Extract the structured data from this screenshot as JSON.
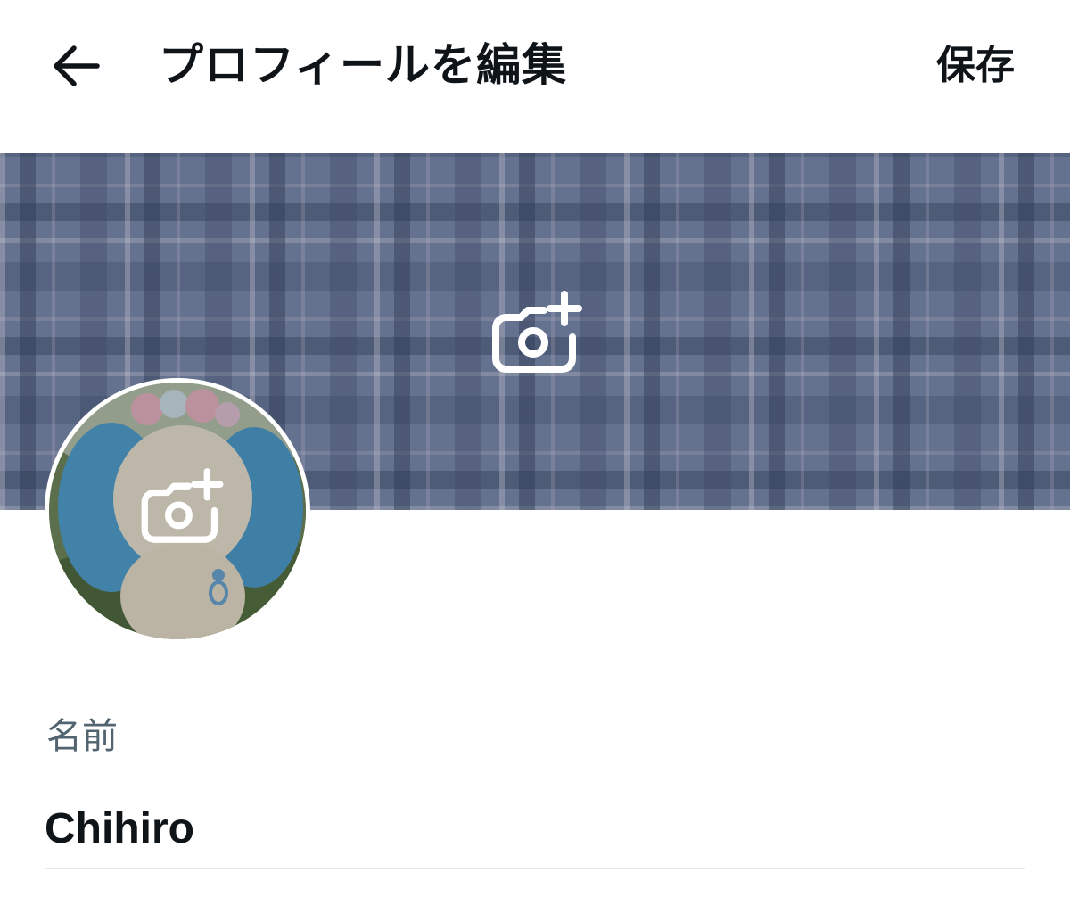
{
  "header": {
    "title": "プロフィールを編集",
    "save_label": "保存",
    "back_icon": "arrow-left-icon"
  },
  "banner": {
    "camera_icon": "camera-add-icon",
    "pattern": "plaid",
    "colors": {
      "base": "#6b7896",
      "dark_stripe": "#28344e",
      "light_stripe": "#f5eef2"
    }
  },
  "avatar": {
    "camera_icon": "camera-add-icon"
  },
  "form": {
    "name": {
      "label": "名前",
      "value": "Chihiro"
    }
  },
  "colors": {
    "text_primary": "#0f1419",
    "text_secondary": "#536471",
    "divider": "#e6e9ee",
    "background": "#ffffff"
  }
}
